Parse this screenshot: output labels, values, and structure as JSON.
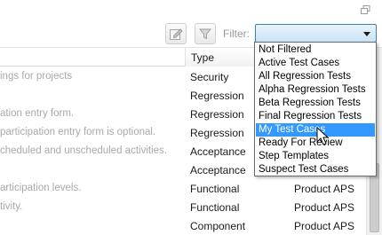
{
  "window": {
    "restore_icon": "restore-window-icon"
  },
  "toolbar": {
    "edit_icon": "edit-icon",
    "filter_funnel_icon": "funnel-icon",
    "filter_label": "Filter:",
    "filter_value": ""
  },
  "grid": {
    "type_header": "Type",
    "rows": [
      {
        "desc": "ings for projects",
        "type": "Security",
        "product": ""
      },
      {
        "desc": "",
        "type": "Regression",
        "product": ""
      },
      {
        "desc": "ation entry form.",
        "type": "Regression",
        "product": ""
      },
      {
        "desc": "participation entry form is optional.",
        "type": "Regression",
        "product": ""
      },
      {
        "desc": "cheduled and unscheduled activities.",
        "type": "Acceptance",
        "product": ""
      },
      {
        "desc": "",
        "type": "Acceptance",
        "product": ""
      },
      {
        "desc": "articipation levels.",
        "type": "Functional",
        "product": "Product APS"
      },
      {
        "desc": "tivity.",
        "type": "Functional",
        "product": "Product APS"
      },
      {
        "desc": "",
        "type": "Component",
        "product": "Product APS"
      }
    ]
  },
  "filter_dropdown": {
    "options": [
      "Not Filtered",
      "Active Test Cases",
      "All Regression Tests",
      "Alpha Regression Tests",
      "Beta Regression Tests",
      "Final Regression Tests",
      "My Test Cases",
      "Ready For Review",
      "Step Templates",
      "Suspect Test Cases"
    ],
    "highlighted": "My Test Cases"
  },
  "colors": {
    "highlight": "#3399ff",
    "select_border": "#3c7fb1"
  }
}
